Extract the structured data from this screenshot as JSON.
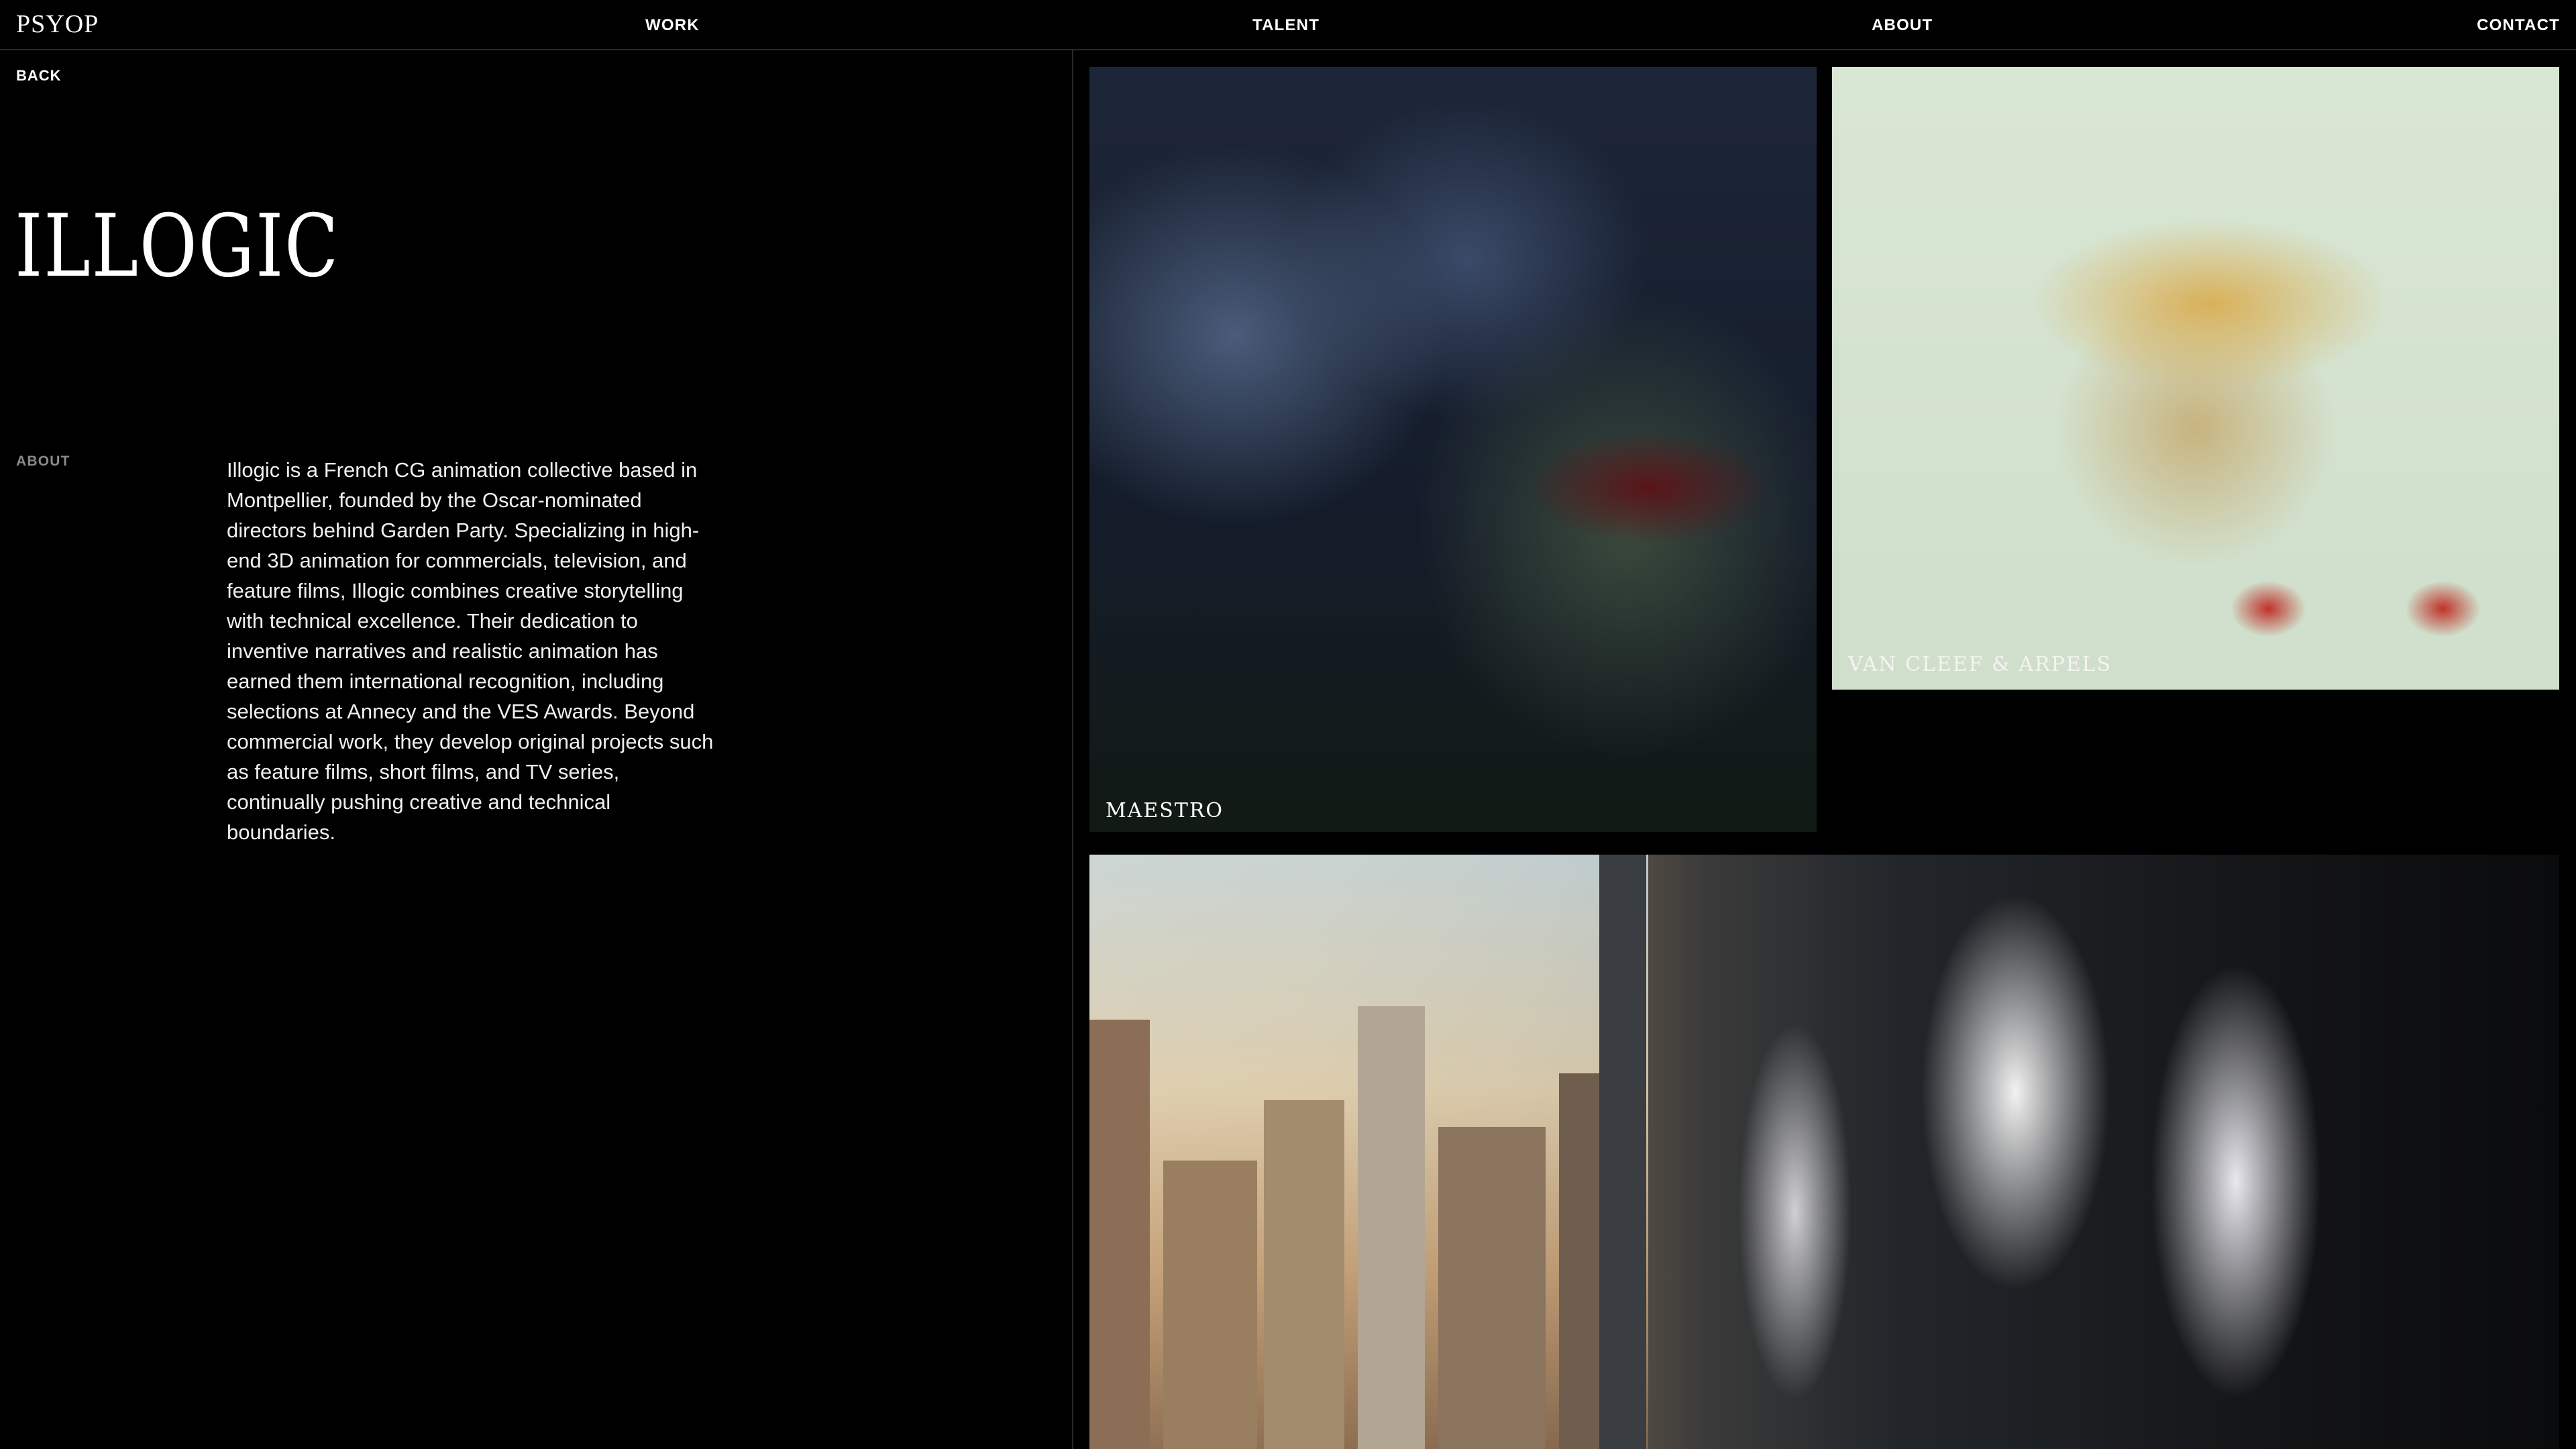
{
  "header": {
    "logo": "PSYOP",
    "nav": {
      "work": "WORK",
      "talent": "TALENT",
      "about": "ABOUT",
      "contact": "CONTACT"
    }
  },
  "back_label": "BACK",
  "page_title": "ILLOGIC",
  "about": {
    "label": "ABOUT",
    "text": "Illogic is a French CG animation collective based in Montpellier, founded by the Oscar-nominated directors behind Garden Party. Specializing in high-end 3D animation for commercials, television, and feature films, Illogic combines creative storytelling with technical excellence. Their dedication to inventive narratives and realistic animation has earned them international recognition, including selections at Annecy and the VES Awards. Beyond commercial work, they develop original projects such as feature films, short films, and TV series, continually pushing creative and technical boundaries."
  },
  "work_tiles": [
    {
      "caption": "MAESTRO"
    },
    {
      "caption": "VAN CLEEF & ARPELS"
    },
    {
      "caption": ""
    }
  ],
  "colors": {
    "background": "#000000",
    "text": "#ffffff",
    "muted_label": "#8a8a8a",
    "divider": "#2a2a2a"
  }
}
